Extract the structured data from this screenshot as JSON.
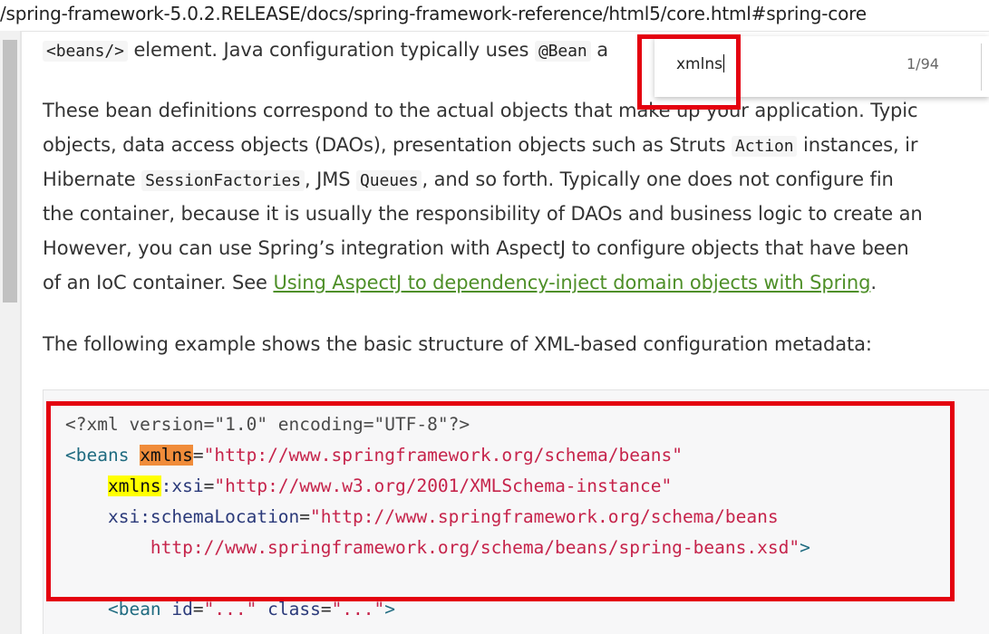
{
  "address_bar": {
    "url": "/spring-framework-5.0.2.RELEASE/docs/spring-framework-reference/html5/core.html#spring-core"
  },
  "find_bar": {
    "query": "xmlns",
    "match_count": "1/94"
  },
  "doc": {
    "line0": {
      "code1": "<beans/>",
      "text1": " element. Java configuration typically uses ",
      "code2": "@Bean",
      "text2": " a"
    },
    "para1": {
      "l1": "These bean definitions correspond to the actual objects that make up your application. Typic",
      "l2a": "objects, data access objects (DAOs), presentation objects such as Struts ",
      "l2code": "Action",
      "l2b": " instances, ir",
      "l3a": "Hibernate ",
      "l3code1": "SessionFactories",
      "l3b": ", JMS ",
      "l3code2": "Queues",
      "l3c": ", and so forth. Typically one does not configure fin",
      "l4": "the container, because it is usually the responsibility of DAOs and business logic to create an",
      "l5": "However, you can use Spring’s integration with AspectJ to configure objects that have been",
      "l6a": "of an IoC container. See ",
      "l6link": "Using AspectJ to dependency-inject domain objects with Spring",
      "l6b": "."
    },
    "para2": "The following example shows the basic structure of XML-based configuration metadata:"
  },
  "code": {
    "l1": {
      "pi": "<?xml version=\"1.0\" encoding=\"UTF-8\"?>"
    },
    "l2": {
      "open": "<beans ",
      "attr": "xmlns",
      "eq": "=",
      "val": "\"http://www.springframework.org/schema/beans\""
    },
    "l3": {
      "indent": "    ",
      "attr": "xmlns",
      "rest": ":xsi",
      "eq": "=",
      "val": "\"http://www.w3.org/2001/XMLSchema-instance\""
    },
    "l4": {
      "indent": "    ",
      "attr": "xsi:schemaLocation",
      "eq": "=",
      "val": "\"http://www.springframework.org/schema/beans"
    },
    "l5": {
      "indent": "        ",
      "val": "http://www.springframework.org/schema/beans/spring-beans.xsd\"",
      "close": ">"
    },
    "l6": {
      "indent": "    ",
      "open": "<bean ",
      "attr1": "id",
      "eq1": "=",
      "val1": "\"...\"",
      "sp": " ",
      "attr2": "class",
      "eq2": "=",
      "val2": "\"...\"",
      "close": ">"
    }
  },
  "colors": {
    "annotation_red": "#e4000f",
    "current_match": "#f08c3a",
    "other_match": "#ffff00",
    "link": "#4e8f28"
  }
}
